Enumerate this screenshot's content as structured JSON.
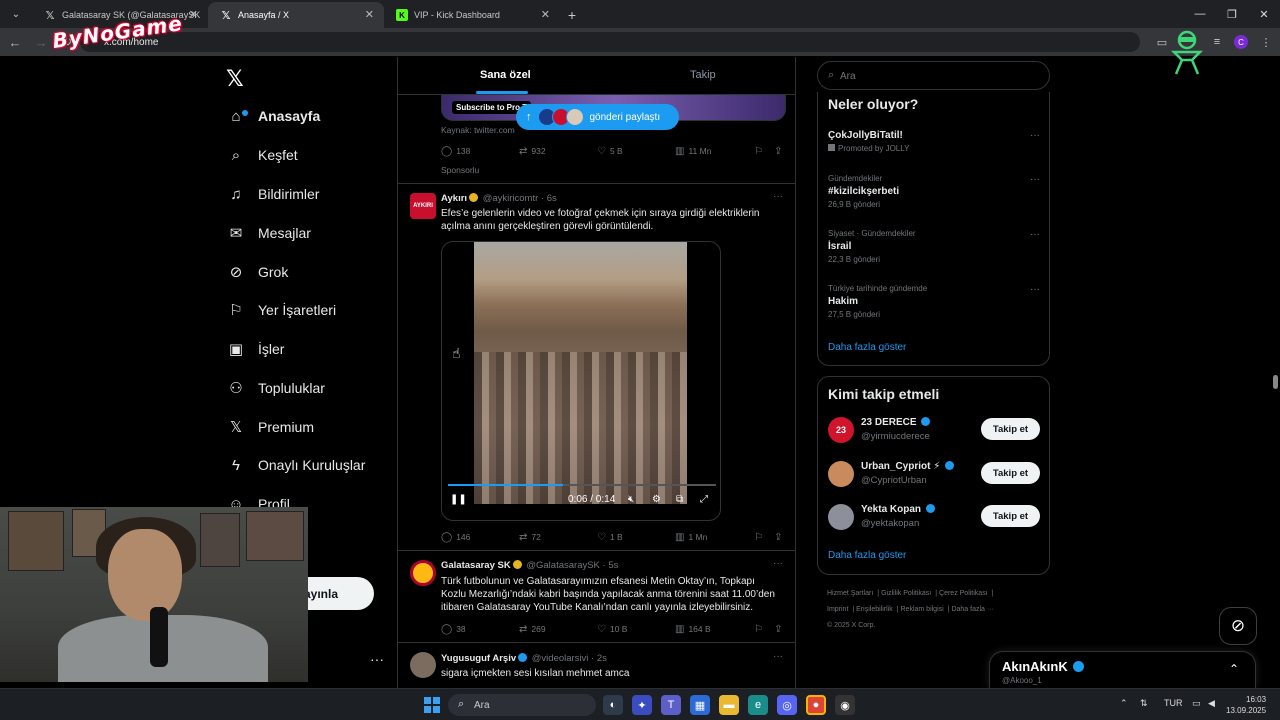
{
  "browser": {
    "tabs": [
      {
        "title": "Galatasaray SK (@GalatasaraySK",
        "icon": "x-icon",
        "active": false
      },
      {
        "title": "Anasayfa / X",
        "icon": "x-icon",
        "active": true
      },
      {
        "title": "VIP - Kick Dashboard",
        "icon": "kick-icon",
        "active": false
      }
    ],
    "new_tab": "+",
    "url": "x.com/home",
    "profile_initial": "C"
  },
  "overlay": {
    "logo_text": "ByNoGame"
  },
  "nav": {
    "items": [
      {
        "label": "Anasayfa",
        "icon": "home-icon"
      },
      {
        "label": "Keşfet",
        "icon": "search-icon"
      },
      {
        "label": "Bildirimler",
        "icon": "bell-icon"
      },
      {
        "label": "Mesajlar",
        "icon": "mail-icon"
      },
      {
        "label": "Grok",
        "icon": "grok-icon"
      },
      {
        "label": "Yer İşaretleri",
        "icon": "bookmark-icon"
      },
      {
        "label": "İşler",
        "icon": "briefcase-icon"
      },
      {
        "label": "Topluluklar",
        "icon": "people-icon"
      },
      {
        "label": "Premium",
        "icon": "x-icon"
      },
      {
        "label": "Onaylı Kuruluşlar",
        "icon": "lightning-icon"
      },
      {
        "label": "Profil",
        "icon": "person-icon"
      },
      {
        "label": "zla",
        "icon": "more-icon"
      }
    ],
    "post_button": "ayınla"
  },
  "timeline": {
    "tabs": [
      "Sana özel",
      "Takip"
    ],
    "ad": {
      "subscribe": "Subscribe to Pro T",
      "source": "Kaynak: twitter.com",
      "share_pill": "gönderi paylaştı",
      "stats": {
        "replies": "138",
        "reposts": "932",
        "likes": "5 B",
        "views": "11 Mn"
      },
      "sponsored": "Sponsorlu"
    },
    "tweets": [
      {
        "name": "Aykırı",
        "handle": "@aykiricomtr",
        "time": "6s",
        "avatar_text": "AYKIRI",
        "text": "Efes’e gelenlerin video ve fotoğraf çekmek için sıraya girdiği elektriklerin açılma anını gerçekleştiren görevli görüntülendi.",
        "video": {
          "time": "0:06 / 0:14",
          "progress": 0.43
        },
        "stats": {
          "replies": "146",
          "reposts": "72",
          "likes": "1 B",
          "views": "1 Mn"
        }
      },
      {
        "name": "Galatasaray SK",
        "handle": "@GalatasaraySK",
        "time": "5s",
        "text": "Türk futbolunun ve Galatasarayımızın efsanesi Metin Oktay’ın, Topkapı Kozlu Mezarlığı’ndaki kabri başında yapılacak anma törenini saat 11.00’den itibaren Galatasaray YouTube Kanalı’ndan canlı yayınla izleyebilirsiniz.",
        "stats": {
          "replies": "38",
          "reposts": "269",
          "likes": "10 B",
          "views": "164 B"
        }
      },
      {
        "name": "Yugusuguf Arşiv",
        "handle": "@videolarsivi",
        "time": "2s",
        "text": "sigara içmekten sesi kısılan mehmet amca"
      }
    ]
  },
  "sidebar": {
    "search_placeholder": "Ara",
    "trends_title": "Neler oluyor?",
    "trends": [
      {
        "context": "",
        "name": "ÇokJollyBiTatil!",
        "count": "Promoted by JOLLY"
      },
      {
        "context": "Gündemdekiler",
        "name": "#kizilcikşerbeti",
        "count": "26,9 B gönderi"
      },
      {
        "context": "Siyaset · Gündemdekiler",
        "name": "İsrail",
        "count": "22,3 B gönderi"
      },
      {
        "context": "Türkiye tarihinde gündemde",
        "name": "Hakim",
        "count": "27,5 B gönderi"
      }
    ],
    "trends_more": "Daha fazla göster",
    "follow_title": "Kimi takip etmeli",
    "follow": [
      {
        "name": "23 DERECE",
        "handle": "@yirmiucderece",
        "button": "Takip et"
      },
      {
        "name": "Urban_Cypriot ⚡",
        "handle": "@CypriotUrban",
        "button": "Takip et"
      },
      {
        "name": "Yekta Kopan",
        "handle": "@yektakopan",
        "button": "Takip et"
      }
    ],
    "follow_more": "Daha fazla göster",
    "footer": [
      "Hizmet Şartları",
      "Gizlilik Politikası",
      "Çerez Politikası",
      "Imprint",
      "Erişilebilirlik",
      "Reklam bilgisi",
      "Daha fazla ···",
      "© 2025 X Corp."
    ]
  },
  "messages": {
    "name": "AkınAkınK",
    "handle": "@Akooo_1"
  },
  "taskbar": {
    "search": "Ara",
    "lang": "TUR",
    "time": "16:03",
    "date": "13.09.2025"
  },
  "colors": {
    "accent": "#1d9bf0",
    "bg": "#000000",
    "border": "#2f3336",
    "muted": "#71767b"
  }
}
